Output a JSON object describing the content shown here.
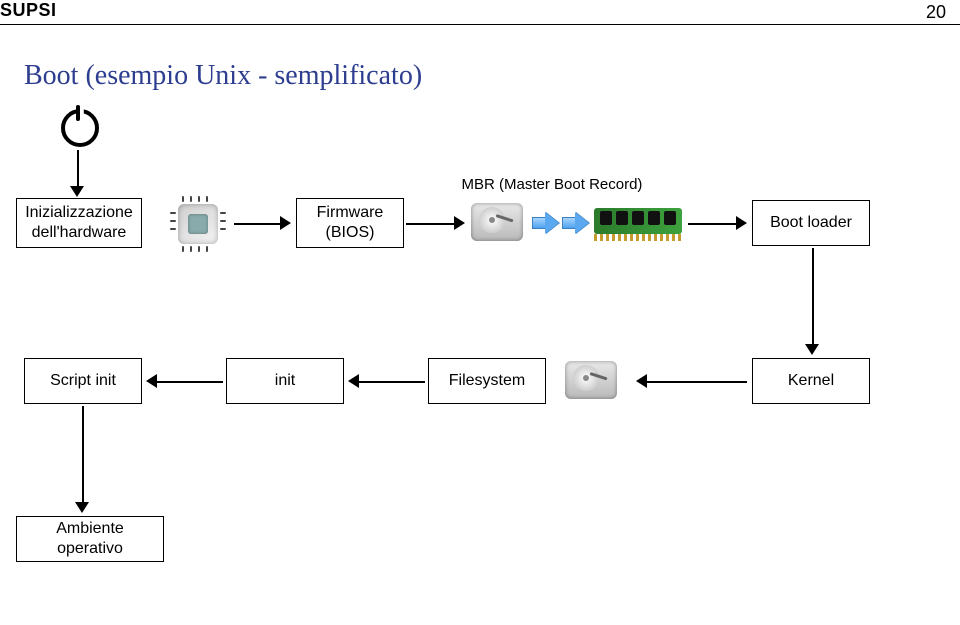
{
  "header": {
    "logo": "SUPSI",
    "page_number": "20"
  },
  "title": "Boot (esempio Unix - semplificato)",
  "labels": {
    "mbr": "MBR (Master Boot Record)"
  },
  "nodes": {
    "hw_init_l1": "Inizializzazione",
    "hw_init_l2": "dell'hardware",
    "firmware_l1": "Firmware",
    "firmware_l2": "(BIOS)",
    "boot_loader": "Boot loader",
    "script_init": "Script init",
    "init": "init",
    "filesystem": "Filesystem",
    "kernel": "Kernel",
    "env": "Ambiente operativo"
  },
  "icons": {
    "power": "power-icon",
    "cpu": "cpu-icon",
    "hdd": "hdd-icon",
    "ram": "ram-icon"
  }
}
